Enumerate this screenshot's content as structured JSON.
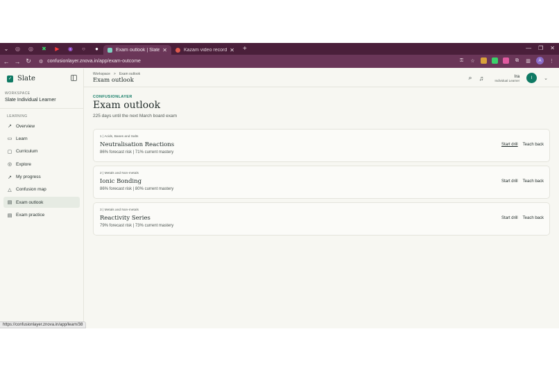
{
  "browser": {
    "tabs": [
      {
        "label": "Exam outlook | Slate",
        "active": true,
        "favicon_color": "#7fd1c1"
      },
      {
        "label": "Kazam video recording i",
        "active": false,
        "favicon_color": "#e05a4e"
      }
    ],
    "url": "confusionlayer.znova.in/app/exam-outcome"
  },
  "sidebar": {
    "brand": "Slate",
    "workspace_label": "WORKSPACE",
    "workspace_name": "Slate Individual Learner",
    "section_label": "LEARNING",
    "items": [
      {
        "label": "Overview",
        "icon": "chart-line-icon",
        "glyph": "↗"
      },
      {
        "label": "Learn",
        "icon": "book-icon",
        "glyph": "▭"
      },
      {
        "label": "Curriculum",
        "icon": "folder-icon",
        "glyph": "▢"
      },
      {
        "label": "Explore",
        "icon": "compass-icon",
        "glyph": "◎"
      },
      {
        "label": "My progress",
        "icon": "trend-icon",
        "glyph": "↗"
      },
      {
        "label": "Confusion map",
        "icon": "warning-icon",
        "glyph": "△"
      },
      {
        "label": "Exam outlook",
        "icon": "clipboard-icon",
        "glyph": "▤",
        "active": true
      },
      {
        "label": "Exam practice",
        "icon": "clipboard-check-icon",
        "glyph": "▤"
      }
    ]
  },
  "topbar": {
    "breadcrumb": [
      "Workspace",
      "Exam outlook"
    ],
    "breadcrumb_sep": ">",
    "title": "Exam outlook",
    "user_name": "Ira",
    "user_role": "Individual Learner",
    "avatar_initial": "I"
  },
  "page": {
    "eyebrow": "CONFUSIONLAYER",
    "title": "Exam outlook",
    "subtitle": "225 days until the next March board exam"
  },
  "cards": [
    {
      "meta": "1 | Acids, Bases and Salts",
      "title": "Neutralisation Reactions",
      "stats": "86% forecast risk | 71% current mastery",
      "start": "Start drill",
      "teach": "Teach back"
    },
    {
      "meta": "2 | Metals and Non-metals",
      "title": "Ionic Bonding",
      "stats": "86% forecast risk | 80% current mastery",
      "start": "Start drill",
      "teach": "Teach back"
    },
    {
      "meta": "3 | Metals and Non-metals",
      "title": "Reactivity Series",
      "stats": "79% forecast risk | 73% current mastery",
      "start": "Start drill",
      "teach": "Teach back"
    }
  ],
  "status_bar_url": "https://confusionlayer.znova.in/app/learn/38",
  "colors": {
    "accent": "#0f7a64",
    "browser_tab_bar": "#4a1f3a",
    "browser_address_bar": "#6a3658"
  }
}
